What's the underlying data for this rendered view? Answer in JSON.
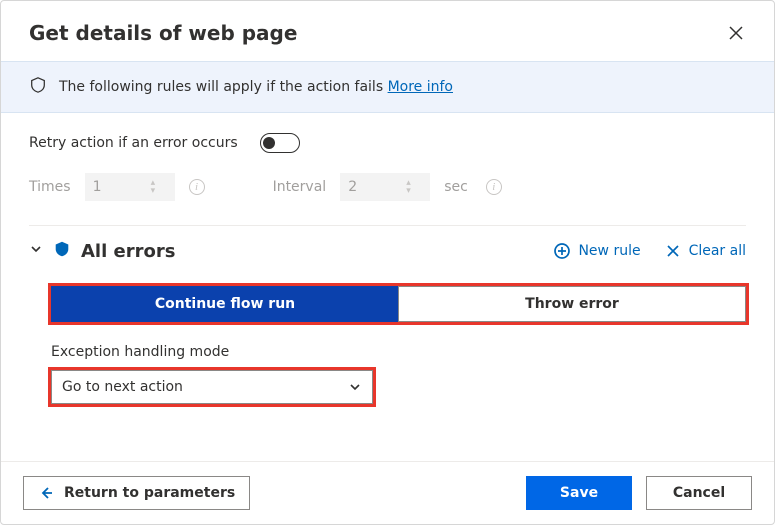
{
  "header": {
    "title": "Get details of web page"
  },
  "infobar": {
    "text": "The following rules will apply if the action fails",
    "link": "More info"
  },
  "retry": {
    "label": "Retry action if an error occurs",
    "enabled": false,
    "timesLabel": "Times",
    "timesValue": "1",
    "intervalLabel": "Interval",
    "intervalValue": "2",
    "secLabel": "sec"
  },
  "errors": {
    "title": "All errors",
    "newRule": "New rule",
    "clearAll": "Clear all",
    "tabContinue": "Continue flow run",
    "tabThrow": "Throw error",
    "modeLabel": "Exception handling mode",
    "modeValue": "Go to next action"
  },
  "footer": {
    "return": "Return to parameters",
    "save": "Save",
    "cancel": "Cancel"
  }
}
